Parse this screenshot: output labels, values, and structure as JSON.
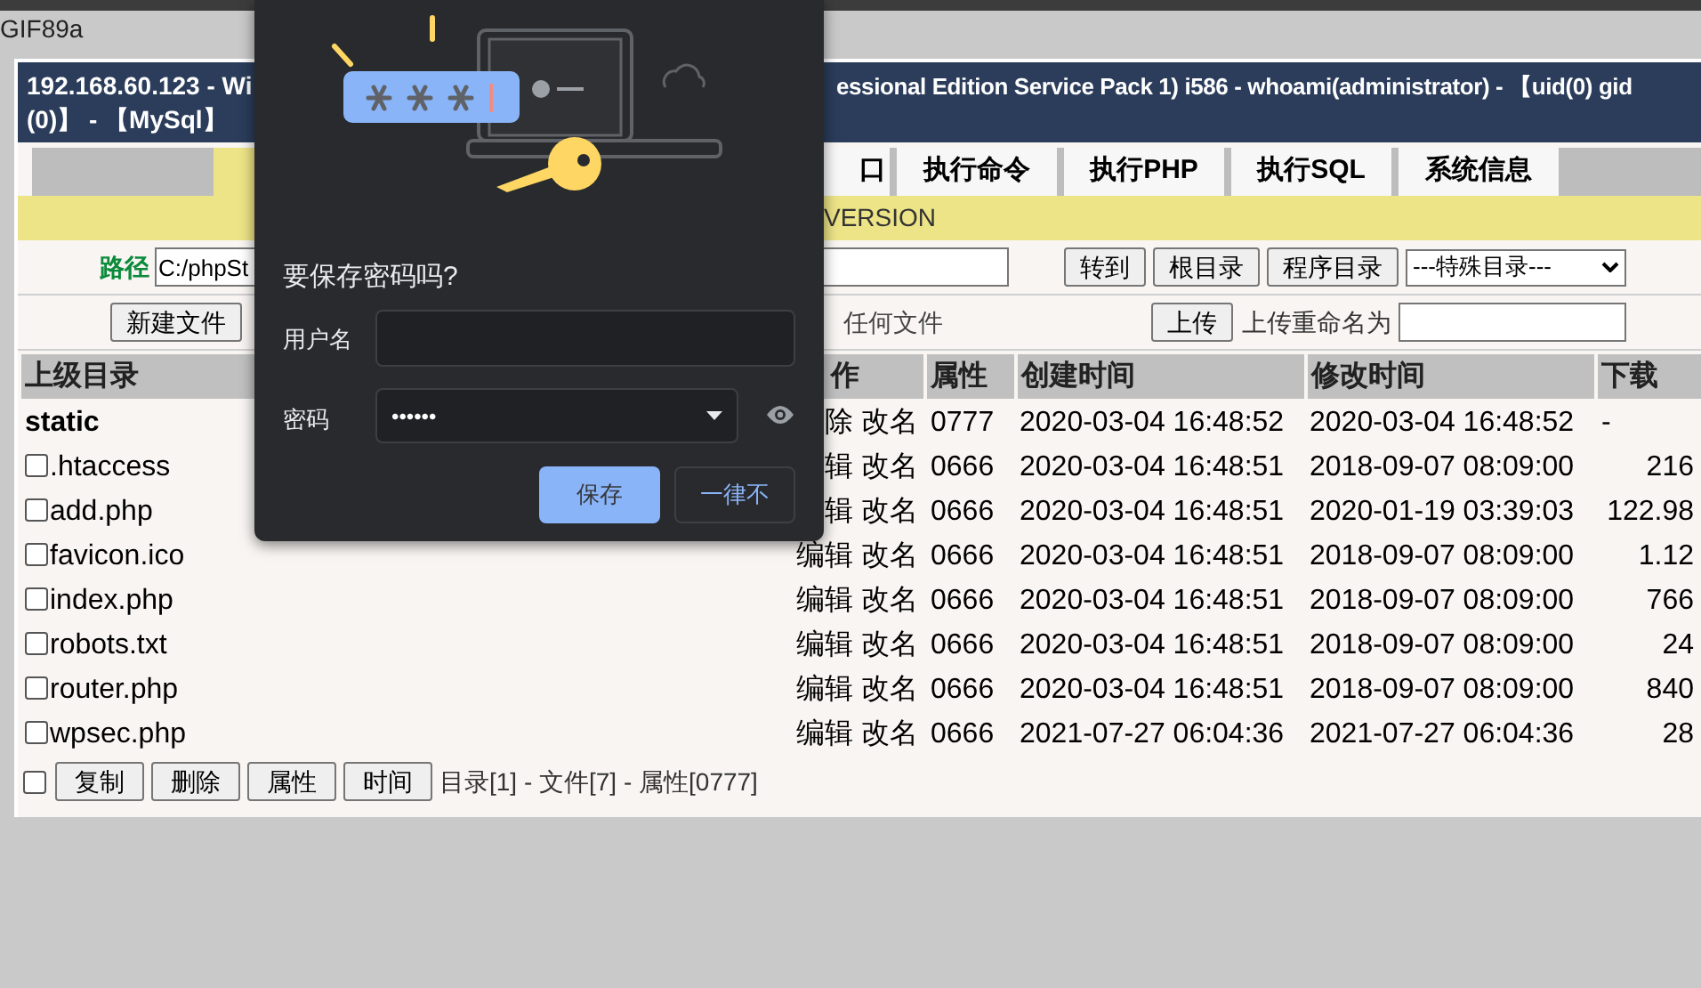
{
  "browser_text": "GIF89a",
  "header": {
    "line_1_left": "192.168.60.123 - Wi",
    "line_1_right": "essional Edition Service Pack 1) i586 - whoami(administrator) - 【uid(0) gid",
    "line_2": "(0)】 - 【MySql】"
  },
  "tabs": [
    {
      "selected": true
    },
    {
      "label": "口",
      "selected": false
    },
    {
      "label": "执行命令",
      "selected": false
    },
    {
      "label": "执行PHP",
      "selected": false
    },
    {
      "label": "执行SQL",
      "selected": false
    },
    {
      "label": "系统信息",
      "selected": false
    }
  ],
  "info_bar": "VERSION",
  "path_bar": {
    "label": "路径",
    "value": "C:/phpSt",
    "buttons": [
      "转到",
      "根目录",
      "程序目录"
    ],
    "special_dir_select": "---特殊目录---"
  },
  "file_bar": {
    "buttons": [
      "新建文件"
    ],
    "note": "任何文件",
    "upload_button": "上传",
    "rename_label": "上传重命名为"
  },
  "table": {
    "columns": [
      "上级目录",
      "作",
      "属性",
      "创建时间",
      "修改时间",
      "下载"
    ],
    "rows": [
      {
        "kind": "dir",
        "name": "static",
        "actions": "除 改名",
        "attr": "0777",
        "created": "2020-03-04 16:48:52",
        "modified": "2020-03-04 16:48:52",
        "download": "-"
      },
      {
        "kind": "file",
        "checked": false,
        "name": ".htaccess",
        "actions": "辑 改名",
        "attr": "0666",
        "created": "2020-03-04 16:48:51",
        "modified": "2018-09-07 08:09:00",
        "download": "216"
      },
      {
        "kind": "file",
        "checked": false,
        "name": "add.php",
        "actions": "辑 改名",
        "attr": "0666",
        "created": "2020-03-04 16:48:51",
        "modified": "2020-01-19 03:39:03",
        "download": "122.98"
      },
      {
        "kind": "file",
        "checked": false,
        "name": "favicon.ico",
        "actions": "编辑 改名",
        "attr": "0666",
        "created": "2020-03-04 16:48:51",
        "modified": "2018-09-07 08:09:00",
        "download": "1.12"
      },
      {
        "kind": "file",
        "checked": false,
        "name": "index.php",
        "actions": "编辑 改名",
        "attr": "0666",
        "created": "2020-03-04 16:48:51",
        "modified": "2018-09-07 08:09:00",
        "download": "766"
      },
      {
        "kind": "file",
        "checked": false,
        "name": "robots.txt",
        "actions": "编辑 改名",
        "attr": "0666",
        "created": "2020-03-04 16:48:51",
        "modified": "2018-09-07 08:09:00",
        "download": "24"
      },
      {
        "kind": "file",
        "checked": false,
        "name": "router.php",
        "actions": "编辑 改名",
        "attr": "0666",
        "created": "2020-03-04 16:48:51",
        "modified": "2018-09-07 08:09:00",
        "download": "840"
      },
      {
        "kind": "file",
        "checked": false,
        "name": "wpsec.php",
        "actions": "编辑 改名",
        "attr": "0666",
        "created": "2021-07-27 06:04:36",
        "modified": "2021-07-27 06:04:36",
        "download": "28"
      }
    ]
  },
  "footer": {
    "select_all_checked": false,
    "buttons": [
      "复制",
      "删除",
      "属性",
      "时间"
    ],
    "summary": "目录[1] - 文件[7] - 属性[0777]"
  },
  "save_password_dialog": {
    "title": "要保存密码吗?",
    "username_label": "用户名",
    "password_label": "密码",
    "password_value": "••••••",
    "buttons": [
      {
        "label": "保存",
        "kind": "primary"
      },
      {
        "label": "一律不",
        "kind": "secondary"
      }
    ]
  }
}
